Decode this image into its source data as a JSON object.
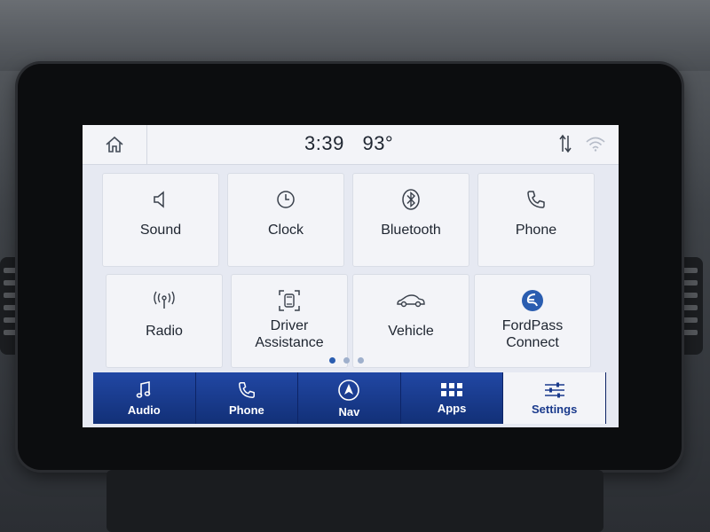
{
  "status": {
    "time": "3:39",
    "temperature": "93°"
  },
  "tiles": [
    {
      "id": "sound",
      "label": "Sound",
      "icon": "speaker-icon"
    },
    {
      "id": "clock",
      "label": "Clock",
      "icon": "clock-icon"
    },
    {
      "id": "bluetooth",
      "label": "Bluetooth",
      "icon": "bluetooth-icon"
    },
    {
      "id": "phone",
      "label": "Phone",
      "icon": "phone-icon"
    },
    {
      "id": "radio",
      "label": "Radio",
      "icon": "antenna-icon"
    },
    {
      "id": "driver-assistance",
      "label_line1": "Driver",
      "label_line2": "Assistance",
      "icon": "driver-assist-icon"
    },
    {
      "id": "vehicle",
      "label": "Vehicle",
      "icon": "car-icon"
    },
    {
      "id": "fordpass",
      "label_line1": "FordPass",
      "label_line2": "Connect",
      "icon": "fordpass-icon"
    }
  ],
  "pagination": {
    "pages": 3,
    "active": 1
  },
  "nav": [
    {
      "id": "audio",
      "label": "Audio",
      "icon": "music-note-icon"
    },
    {
      "id": "phone",
      "label": "Phone",
      "icon": "phone-icon"
    },
    {
      "id": "nav",
      "label": "Nav",
      "icon": "navigation-arrow-icon"
    },
    {
      "id": "apps",
      "label": "Apps",
      "icon": "apps-grid-icon"
    },
    {
      "id": "settings",
      "label": "Settings",
      "icon": "sliders-icon",
      "selected": true
    }
  ],
  "colors": {
    "accent": "#1a3a8c",
    "screen_bg": "#e6e9f2",
    "tile_bg": "#f3f4f8",
    "fordpass_blue": "#2a5db0"
  }
}
